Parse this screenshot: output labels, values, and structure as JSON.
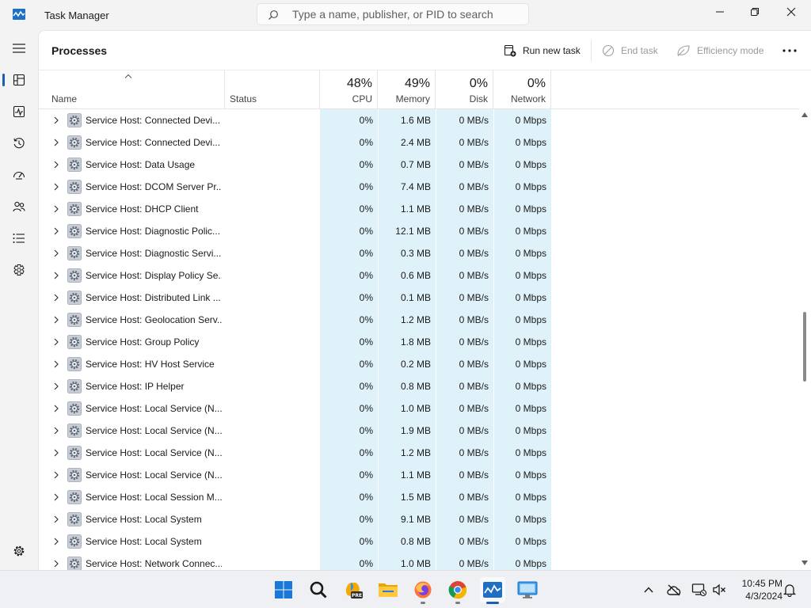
{
  "window": {
    "title": "Task Manager"
  },
  "search": {
    "placeholder": "Type a name, publisher, or PID to search"
  },
  "page": {
    "title": "Processes"
  },
  "toolbar": {
    "run_new_task": "Run new task",
    "end_task": "End task",
    "efficiency_mode": "Efficiency mode"
  },
  "columns": {
    "name": "Name",
    "status": "Status",
    "cpu": {
      "label": "CPU",
      "total": "48%"
    },
    "memory": {
      "label": "Memory",
      "total": "49%"
    },
    "disk": {
      "label": "Disk",
      "total": "0%"
    },
    "network": {
      "label": "Network",
      "total": "0%"
    }
  },
  "processes": [
    {
      "name": "Service Host: Connected Devi...",
      "status": "",
      "cpu": "0%",
      "memory": "1.6 MB",
      "disk": "0 MB/s",
      "network": "0 Mbps"
    },
    {
      "name": "Service Host: Connected Devi...",
      "status": "",
      "cpu": "0%",
      "memory": "2.4 MB",
      "disk": "0 MB/s",
      "network": "0 Mbps"
    },
    {
      "name": "Service Host: Data Usage",
      "status": "",
      "cpu": "0%",
      "memory": "0.7 MB",
      "disk": "0 MB/s",
      "network": "0 Mbps"
    },
    {
      "name": "Service Host: DCOM Server Pr...",
      "status": "",
      "cpu": "0%",
      "memory": "7.4 MB",
      "disk": "0 MB/s",
      "network": "0 Mbps"
    },
    {
      "name": "Service Host: DHCP Client",
      "status": "",
      "cpu": "0%",
      "memory": "1.1 MB",
      "disk": "0 MB/s",
      "network": "0 Mbps"
    },
    {
      "name": "Service Host: Diagnostic Polic...",
      "status": "",
      "cpu": "0%",
      "memory": "12.1 MB",
      "disk": "0 MB/s",
      "network": "0 Mbps"
    },
    {
      "name": "Service Host: Diagnostic Servi...",
      "status": "",
      "cpu": "0%",
      "memory": "0.3 MB",
      "disk": "0 MB/s",
      "network": "0 Mbps"
    },
    {
      "name": "Service Host: Display Policy Se...",
      "status": "",
      "cpu": "0%",
      "memory": "0.6 MB",
      "disk": "0 MB/s",
      "network": "0 Mbps"
    },
    {
      "name": "Service Host: Distributed Link ...",
      "status": "",
      "cpu": "0%",
      "memory": "0.1 MB",
      "disk": "0 MB/s",
      "network": "0 Mbps"
    },
    {
      "name": "Service Host: Geolocation Serv...",
      "status": "",
      "cpu": "0%",
      "memory": "1.2 MB",
      "disk": "0 MB/s",
      "network": "0 Mbps"
    },
    {
      "name": "Service Host: Group Policy",
      "status": "",
      "cpu": "0%",
      "memory": "1.8 MB",
      "disk": "0 MB/s",
      "network": "0 Mbps"
    },
    {
      "name": "Service Host: HV Host Service",
      "status": "",
      "cpu": "0%",
      "memory": "0.2 MB",
      "disk": "0 MB/s",
      "network": "0 Mbps"
    },
    {
      "name": "Service Host: IP Helper",
      "status": "",
      "cpu": "0%",
      "memory": "0.8 MB",
      "disk": "0 MB/s",
      "network": "0 Mbps"
    },
    {
      "name": "Service Host: Local Service (N...",
      "status": "",
      "cpu": "0%",
      "memory": "1.0 MB",
      "disk": "0 MB/s",
      "network": "0 Mbps"
    },
    {
      "name": "Service Host: Local Service (N...",
      "status": "",
      "cpu": "0%",
      "memory": "1.9 MB",
      "disk": "0 MB/s",
      "network": "0 Mbps"
    },
    {
      "name": "Service Host: Local Service (N...",
      "status": "",
      "cpu": "0%",
      "memory": "1.2 MB",
      "disk": "0 MB/s",
      "network": "0 Mbps"
    },
    {
      "name": "Service Host: Local Service (N...",
      "status": "",
      "cpu": "0%",
      "memory": "1.1 MB",
      "disk": "0 MB/s",
      "network": "0 Mbps"
    },
    {
      "name": "Service Host: Local Session M...",
      "status": "",
      "cpu": "0%",
      "memory": "1.5 MB",
      "disk": "0 MB/s",
      "network": "0 Mbps"
    },
    {
      "name": "Service Host: Local System",
      "status": "",
      "cpu": "0%",
      "memory": "9.1 MB",
      "disk": "0 MB/s",
      "network": "0 Mbps"
    },
    {
      "name": "Service Host: Local System",
      "status": "",
      "cpu": "0%",
      "memory": "0.8 MB",
      "disk": "0 MB/s",
      "network": "0 Mbps"
    },
    {
      "name": "Service Host: Network Connec...",
      "status": "",
      "cpu": "0%",
      "memory": "1.0 MB",
      "disk": "0 MB/s",
      "network": "0 Mbps"
    }
  ],
  "nav": [
    "menu-icon",
    "processes-icon",
    "performance-icon",
    "app-history-icon",
    "startup-apps-icon",
    "users-icon",
    "details-icon",
    "services-icon",
    "settings-icon"
  ],
  "taskbar": {
    "apps": [
      "windows-start-icon",
      "search-icon",
      "copilot-pre-icon",
      "file-explorer-icon",
      "firefox-icon",
      "chrome-icon",
      "task-manager-icon",
      "remote-desktop-icon"
    ],
    "clock": {
      "time": "10:45 PM",
      "date": "4/3/2024"
    }
  },
  "colors": {
    "accent": "#1a5fb4",
    "heat": "#dff2fa",
    "panel": "#ffffff",
    "chrome": "#f3f3f3"
  }
}
